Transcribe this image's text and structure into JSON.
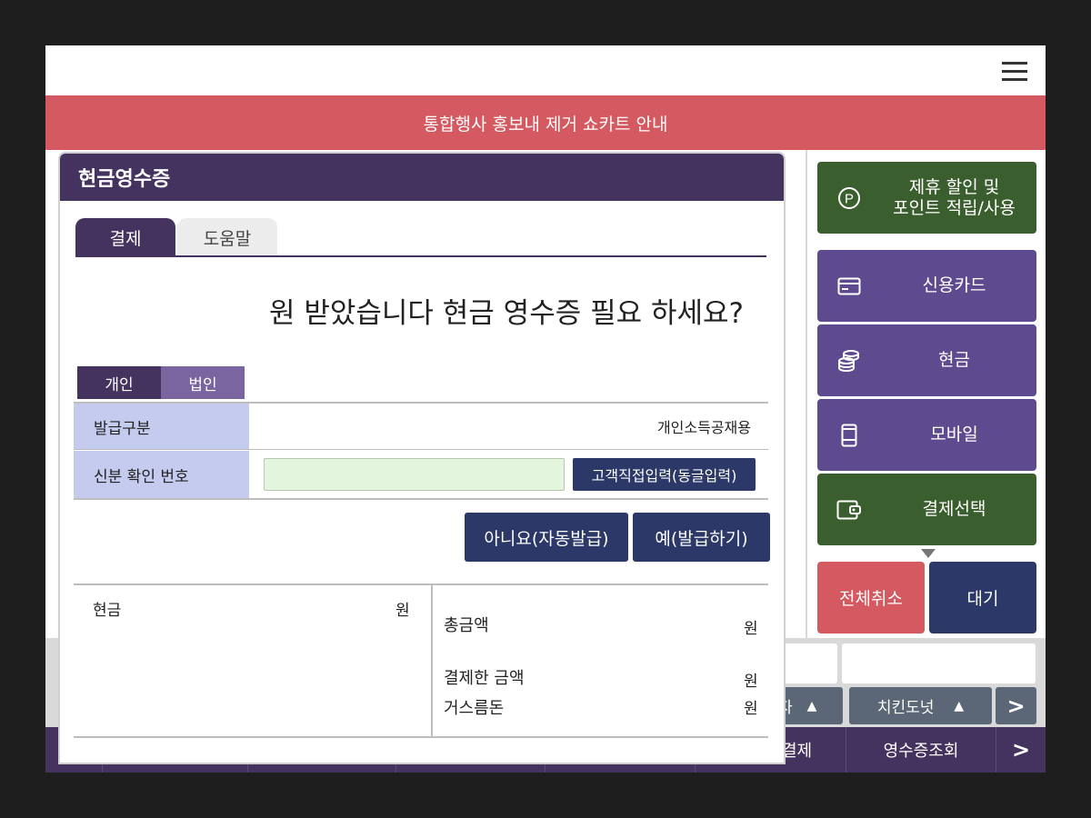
{
  "notice": "통합행사 홍보내 제거 쇼카트 안내",
  "right_panel": {
    "partner_line1": "제휴 할인 및",
    "partner_line2": "포인트 적립/사용",
    "card": "신용카드",
    "cash": "현금",
    "mobile": "모바일",
    "payment_select": "결제선택",
    "cancel_all": "전체취소",
    "wait": "대기"
  },
  "categories": {
    "partial": "자",
    "chicken": "치킨도넛",
    "arrow_up": "▲",
    "next": ">"
  },
  "bottom_bar": {
    "pay": "결제",
    "receipt_lookup": "영수증조회",
    "next": ">"
  },
  "modal": {
    "title": "현금영수증",
    "tabs": {
      "pay": "결제",
      "help": "도움말"
    },
    "question": "원 받았습니다 현금 영수증 필요 하세요?",
    "segments": {
      "personal": "개인",
      "corporate": "법인"
    },
    "form": {
      "issue_type_label": "발급구분",
      "issue_type_value": "개인소득공재용",
      "id_label": "신분 확인 번호",
      "id_value": "",
      "direct_input_button": "고객직접입력(동글입력)"
    },
    "actions": {
      "no": "아니요(자동발급)",
      "yes": "예(발급하기)"
    },
    "summary": {
      "cash_label": "현금",
      "cash_unit": "원",
      "total_label": "총금액",
      "total_unit": "원",
      "paid_label": "결제한 금액",
      "paid_unit": "원",
      "change_label": "거스름돈",
      "change_unit": "원"
    }
  },
  "icons": {
    "menu": "hamburger-menu-icon",
    "partner": "point-p-icon",
    "card": "credit-card-icon",
    "cash": "coin-stack-icon",
    "mobile": "mobile-phone-icon",
    "select": "wallet-icon"
  },
  "colors": {
    "notice_red": "#d45960",
    "header_purple": "#45335f",
    "button_purple": "#5e4b8f",
    "button_green": "#3b5e2e",
    "navy": "#2b3868",
    "label_blue": "#c5cbee",
    "input_green": "#e3f5dc"
  }
}
